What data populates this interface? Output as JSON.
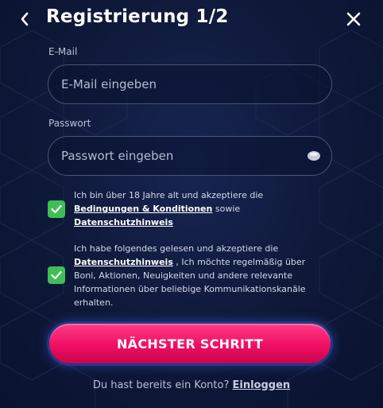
{
  "header": {
    "title": "Registrierung 1/2",
    "back_icon": "chevron-left-icon",
    "close_icon": "close-icon"
  },
  "email": {
    "label": "E-Mail",
    "placeholder": "E-Mail eingeben",
    "value": ""
  },
  "password": {
    "label": "Passwort",
    "placeholder": "Passwort eingeben",
    "value": "",
    "toggle_icon": "eye-icon"
  },
  "consent_age": {
    "checked": true,
    "text_before": "Ich bin über 18 Jahre alt und akzeptiere die ",
    "link_terms": "Bedingungen & Konditionen",
    "text_middle": " sowie ",
    "link_privacy": "Datenschutzhinweis"
  },
  "consent_marketing": {
    "checked": true,
    "text_before": "Ich habe folgendes gelesen und akzeptiere die ",
    "link_privacy": "Datenschutzhinweis",
    "text_after": " , Ich möchte regelmäßig über Boni, Aktionen, Neuigkeiten und andere relevante Informationen über beliebige Kommunikationskanäle erhalten."
  },
  "submit": {
    "label": "NÄCHSTER SCHRITT"
  },
  "login_prompt": {
    "text": "Du hast bereits ein Konto? ",
    "link": "Einloggen"
  },
  "colors": {
    "background": "#0e1838",
    "accent_pink": "#ef0e63",
    "checkbox_green": "#3fbe56",
    "input_border": "#4a5577"
  }
}
